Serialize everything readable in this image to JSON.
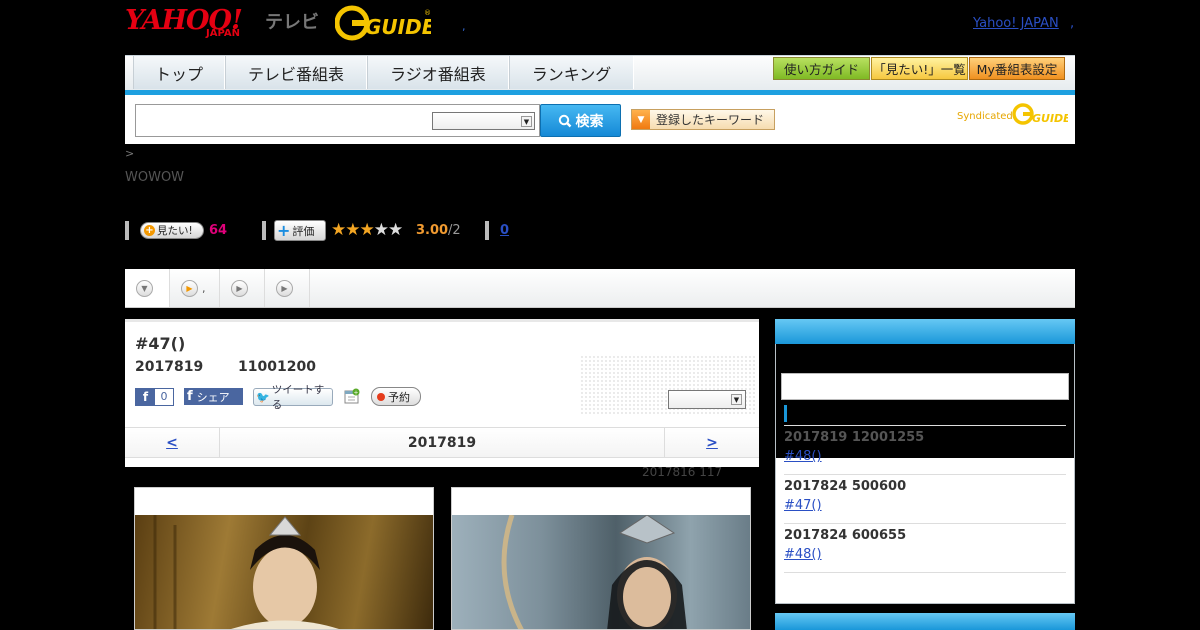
{
  "header": {
    "yahoo_logo": "YAHOO!",
    "japan_label": "JAPAN",
    "tv_label": "テレビ",
    "gguide_logo": "GUIDE",
    "dot": ",",
    "yahoo_japan_link": "Yahoo! JAPAN",
    "yahoo_japan_dot": ","
  },
  "nav": {
    "tabs": [
      "トップ",
      "テレビ番組表",
      "ラジオ番組表",
      "ランキング"
    ],
    "buttons": {
      "guide": "使い方ガイド",
      "mitai_list": "「見たい!」一覧",
      "my_schedule": "My番組表設定"
    }
  },
  "search": {
    "query": "",
    "select_value": "",
    "button_label": "検索",
    "keywords_button": "登録したキーワード",
    "syndicated": "Syndicated"
  },
  "program": {
    "breadcrumb": ">",
    "channel": "WOWOW",
    "mitai_label": "見たい!",
    "mitai_count": "64",
    "hyoka_label": "評価",
    "rating": "3.00",
    "rating_of": "/2",
    "stars_on": 3,
    "stars_total": 5,
    "review_count": "0"
  },
  "tabs": {
    "second_label": ","
  },
  "episode": {
    "title": "#47()",
    "date": "2017819",
    "time": "11001200",
    "fb_like_count": "0",
    "fb_share": "シェア",
    "tweet": "ツイートする",
    "yoyaku": "予約",
    "nav_prev": "<",
    "nav_date": "2017819",
    "nav_next": ">",
    "updated": "2017816  117"
  },
  "sidebar": {
    "items": [
      {
        "time": "2017819  12001255",
        "link": "#48()"
      },
      {
        "time": "2017824  500600",
        "link": "#47()"
      },
      {
        "time": "2017824  600655",
        "link": "#48()"
      }
    ]
  },
  "colors": {
    "accent_blue": "#1ea0e0",
    "yahoo_red": "#e50012",
    "link_blue": "#2a4fc4",
    "mitai_pink": "#e0007a",
    "star_orange": "#f4a623"
  }
}
